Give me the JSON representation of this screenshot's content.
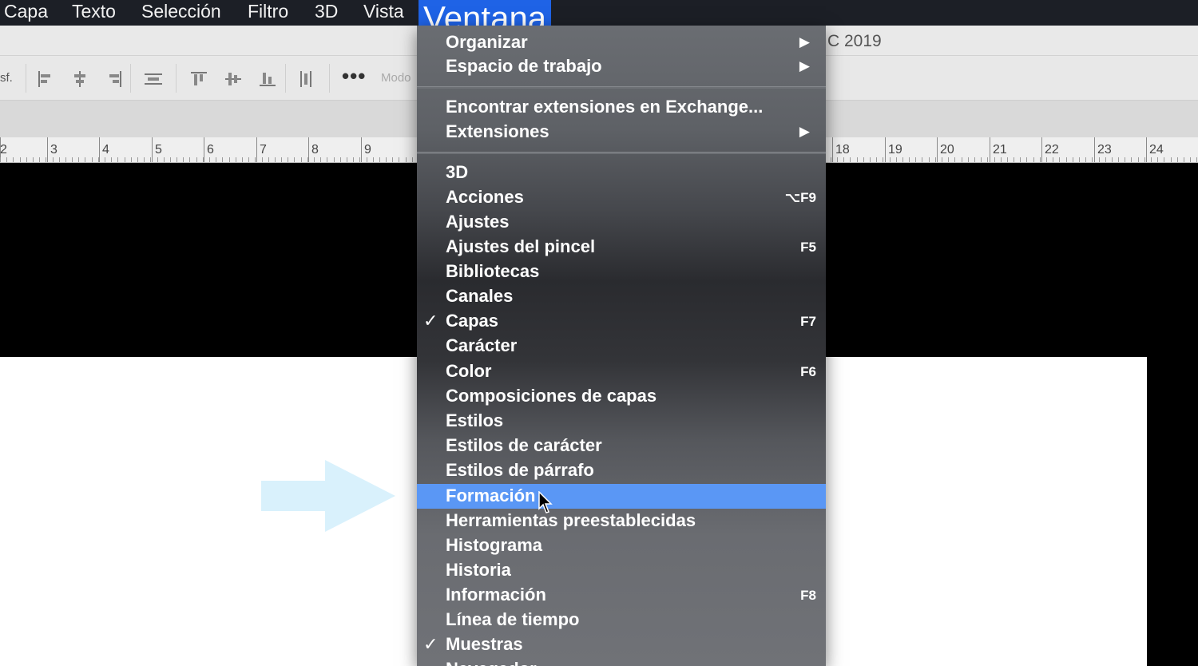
{
  "menubar": {
    "items": [
      "Capa",
      "Texto",
      "Selección",
      "Filtro",
      "3D",
      "Vista"
    ],
    "active": "Ventana"
  },
  "titlestrip": {
    "title": "C 2019"
  },
  "optionsbar": {
    "left_label": "sf.",
    "mode_label": "Modo"
  },
  "ruler": {
    "labels": [
      "2",
      "3",
      "4",
      "5",
      "6",
      "7",
      "8",
      "9",
      "18",
      "19",
      "20",
      "21",
      "22",
      "23",
      "24"
    ]
  },
  "dropdown": {
    "items": [
      {
        "label": "Organizar",
        "submenu": "▶"
      },
      {
        "label": "Espacio de trabajo",
        "submenu": "▶"
      },
      {
        "label": "Encontrar extensiones en Exchange..."
      },
      {
        "label": "Extensiones",
        "submenu": "▶"
      },
      {
        "label": "3D"
      },
      {
        "label": "Acciones",
        "shortcut": "⌥F9"
      },
      {
        "label": "Ajustes"
      },
      {
        "label": "Ajustes del pincel",
        "shortcut": "F5"
      },
      {
        "label": "Bibliotecas"
      },
      {
        "label": "Canales"
      },
      {
        "label": "Capas",
        "shortcut": "F7",
        "check": "✓"
      },
      {
        "label": "Carácter"
      },
      {
        "label": "Color",
        "shortcut": "F6"
      },
      {
        "label": "Composiciones de capas"
      },
      {
        "label": "Estilos"
      },
      {
        "label": "Estilos de carácter"
      },
      {
        "label": "Estilos de párrafo"
      },
      {
        "label": "Formación"
      },
      {
        "label": "Herramientas preestablecidas"
      },
      {
        "label": "Histograma"
      },
      {
        "label": "Historia"
      },
      {
        "label": "Información",
        "shortcut": "F8"
      },
      {
        "label": "Línea de tiempo"
      },
      {
        "label": "Muestras",
        "check": "✓"
      },
      {
        "label": "Navegador"
      }
    ]
  },
  "colors": {
    "highlight": "#5a97f5",
    "menu_active": "#1f63e6",
    "arrow": "#d9f1fc"
  }
}
